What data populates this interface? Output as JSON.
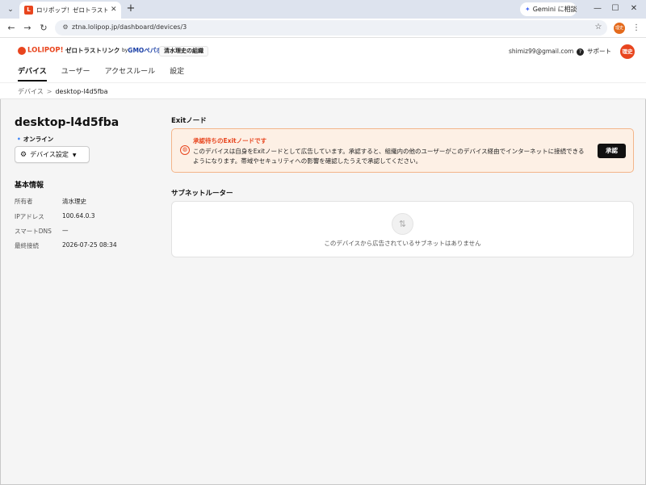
{
  "browser": {
    "tab_title": "ロリポップ！ゼロトラストリンク byGMOペパボ",
    "new_tab": "+",
    "gemini_label": "Gemini に相談",
    "url": "ztna.lolipop.jp/dashboard/devices/3",
    "profile_label": "理史"
  },
  "header": {
    "logo_brand": "LOLIPOP!",
    "logo_product": "ゼロトラストリンク",
    "logo_by": "by",
    "logo_company": "GMOペパボ",
    "org_name": "清水理史の組織",
    "user_email": "shimiz99@gmail.com",
    "support_label": "サポート",
    "avatar_text": "理史",
    "nav": [
      {
        "label": "デバイス",
        "active": true
      },
      {
        "label": "ユーザー",
        "active": false
      },
      {
        "label": "アクセスルール",
        "active": false
      },
      {
        "label": "設定",
        "active": false
      }
    ]
  },
  "breadcrumb": {
    "parent": "デバイス",
    "separator": ">",
    "current": "desktop-l4d5fba"
  },
  "device": {
    "name": "desktop-l4d5fba",
    "status": "オンライン",
    "settings_label": "デバイス設定",
    "info_heading": "基本情報",
    "info": [
      {
        "key": "所有者",
        "value": "清水理史"
      },
      {
        "key": "IPアドレス",
        "value": "100.64.0.3"
      },
      {
        "key": "スマートDNS",
        "value": "—"
      },
      {
        "key": "最終接続",
        "value": "2026-07-25 08:34"
      }
    ]
  },
  "exit_node": {
    "heading": "Exitノード",
    "alert_title": "承認待ちのExitノードです",
    "alert_body": "このデバイスは自身をExitノードとして広告しています。承認すると、組織内の他のユーザーがこのデバイス経由でインターネットに接続できるようになります。帯域やセキュリティへの影響を確認したうえで承認してください。",
    "approve_label": "承認"
  },
  "subnet_router": {
    "heading": "サブネットルーター",
    "empty_text": "このデバイスから広告されているサブネットはありません"
  },
  "colors": {
    "brand": "#e8451e",
    "status_online": "#3b82f6",
    "alert_bg": "#fdf0e5"
  }
}
